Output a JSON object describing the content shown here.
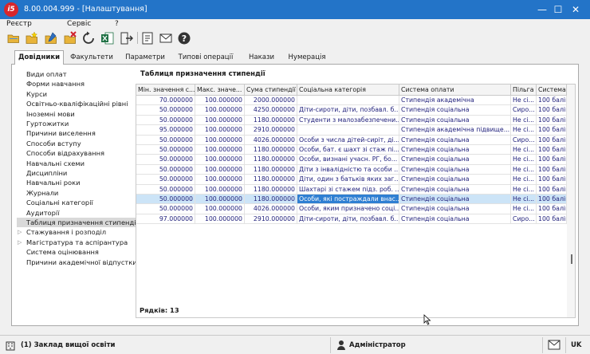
{
  "window": {
    "title": "8.00.004.999 - [Налаштування]",
    "logo_text": "i5",
    "controls": {
      "minimize": "—",
      "maximize": "☐",
      "close": "✕"
    }
  },
  "menu": {
    "items": [
      "Реєстр",
      "Сервіс",
      "?"
    ]
  },
  "toolbar": {
    "icons": [
      "open-folder-icon",
      "new-folder-icon",
      "edit-folder-icon",
      "delete-folder-icon",
      "refresh-icon",
      "export-excel-icon",
      "exit-icon",
      "document-icon",
      "mail-icon",
      "help-icon"
    ]
  },
  "tabs": [
    "Довідники",
    "Факультети",
    "Параметри",
    "Типові операції",
    "Накази",
    "Нумерація"
  ],
  "active_tab": "Довідники",
  "left_list": [
    {
      "label": "Види оплат"
    },
    {
      "label": "Форми навчання"
    },
    {
      "label": "Курси"
    },
    {
      "label": "Освітньо-кваліфікаційні рівні"
    },
    {
      "label": "Іноземні мови"
    },
    {
      "label": "Гуртожитки"
    },
    {
      "label": "Причини виселення"
    },
    {
      "label": "Способи вступу"
    },
    {
      "label": "Способи відрахування"
    },
    {
      "label": "Навчальні схеми"
    },
    {
      "label": "Дисципліни"
    },
    {
      "label": "Навчальні роки"
    },
    {
      "label": "Журнали"
    },
    {
      "label": "Соціальні категорії"
    },
    {
      "label": "Аудиторії"
    },
    {
      "label": "Таблиця призначення стипендії"
    },
    {
      "label": "Стажування і розподіл"
    },
    {
      "label": "Магістратура та аспірантура"
    },
    {
      "label": "Система оцінювання"
    },
    {
      "label": "Причини академічної відпустки"
    }
  ],
  "panel_title": "Таблиця призначення стипендії",
  "table": {
    "columns": [
      "Мін. значення с...",
      "Макс. значе...",
      "Сума стипендії",
      "Соціальна категорія",
      "Система оплати",
      "Пільга",
      "Система"
    ],
    "rows": [
      [
        "70.000000",
        "100.000000",
        "2000.000000",
        "",
        "Стипендія академічна",
        "Не сі...",
        "100 балів"
      ],
      [
        "50.000000",
        "100.000000",
        "4250.000000",
        "Діти-сироти, діти, позбавл. б...",
        "Стипендія соціальна",
        "Сиро...",
        "100 балів"
      ],
      [
        "50.000000",
        "100.000000",
        "1180.000000",
        "Студенти з малозабезпечени...",
        "Стипендія соціальна",
        "Не сі...",
        "100 балів"
      ],
      [
        "95.000000",
        "100.000000",
        "2910.000000",
        "",
        "Стипендія академічна підвище...",
        "Не сі...",
        "100 балів"
      ],
      [
        "50.000000",
        "100.000000",
        "4026.000000",
        "Особи з числа дітей-сиріт, ді...",
        "Стипендія соціальна",
        "Сиро...",
        "100 балів"
      ],
      [
        "50.000000",
        "100.000000",
        "1180.000000",
        "Особи, бат. є шахт зі стаж пі...",
        "Стипендія соціальна",
        "Не сі...",
        "100 балів"
      ],
      [
        "50.000000",
        "100.000000",
        "1180.000000",
        "Особи, визнані учасн. РГ, бо...",
        "Стипендія соціальна",
        "Не сі...",
        "100 балів"
      ],
      [
        "50.000000",
        "100.000000",
        "1180.000000",
        "Діти з інвалідністю та особи ...",
        "Стипендія соціальна",
        "Не сі...",
        "100 балів"
      ],
      [
        "50.000000",
        "100.000000",
        "1180.000000",
        "Діти, один з батьків яких заг...",
        "Стипендія соціальна",
        "Не сі...",
        "100 балів"
      ],
      [
        "50.000000",
        "100.000000",
        "1180.000000",
        "Шахтарі зі стажем підз. роб. ...",
        "Стипендія соціальна",
        "Не сі...",
        "100 балів"
      ],
      [
        "50.000000",
        "100.000000",
        "1180.000000",
        "Особи, які постраждали внас...",
        "Стипендія соціальна",
        "Не сі...",
        "100 балів"
      ],
      [
        "50.000000",
        "100.000000",
        "4026.000000",
        "Особи, яким призначено соці...",
        "Стипендія соціальна",
        "Не сі...",
        "100 балів"
      ],
      [
        "97.000000",
        "100.000000",
        "2910.000000",
        "Діти-сироти, діти, позбавл. б...",
        "Стипендія соціальна",
        "Сиро...",
        "100 балів"
      ]
    ],
    "selected_row": 10
  },
  "row_count_label": "Рядків: 13",
  "status": {
    "left": "(1) Заклад вищої освіти",
    "user": "Адміністратор",
    "lang": "UK"
  },
  "colors": {
    "titlebar": "#2374c8",
    "row_text": "#1e1e7a",
    "selected_row": "#cce4f7",
    "selected_cell": "#2f7fd2"
  }
}
